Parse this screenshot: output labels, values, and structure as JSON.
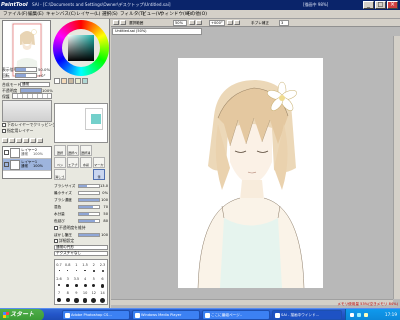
{
  "app": {
    "logo": "PaintTool SAI",
    "title": "SAI - [C:\\Documents and Settings\\Owner\\デスクトップ\\Untitled.sai]",
    "corner_status": "[描画中 98%]"
  },
  "window_buttons": [
    "_",
    "□",
    "×"
  ],
  "menu": [
    "ファイル(F)",
    "編集(E)",
    "キャンバス(C)",
    "レイヤー(L)",
    "選択(S)",
    "フィルタ(T)",
    "ビュー(V)",
    "ウィンドウ(W)",
    "その他(O)"
  ],
  "navigator": {
    "zoom_label": "表示倍率",
    "zoom_value": "50.0%",
    "angle_label": "回転",
    "angle_value": "+0°"
  },
  "layer_settings": {
    "mode_label": "合成モード",
    "mode_value": "通常",
    "opacity_label": "不透明度",
    "opacity_value": "100%",
    "protect_label": "保護",
    "clip_label": "下のレイヤーでクリッピング",
    "select_source_label": "指定用レイヤー"
  },
  "layers": [
    {
      "name": "レイヤー2",
      "mode": "通常",
      "opacity": "100%",
      "selected": false
    },
    {
      "name": "レイヤー1",
      "mode": "通常",
      "opacity": "100%",
      "selected": true
    }
  ],
  "tools": [
    "選択",
    "選択ペン",
    "選択消し",
    "ペン",
    "エアブラシ",
    "水彩",
    "マーカー",
    "消しゴム",
    "筆"
  ],
  "tool_props": {
    "size_label": "ブラシサイズ",
    "size_value": "13.0",
    "min_size_label": "最小サイズ",
    "min_size_value": "0%",
    "density_label": "ブラシ濃度",
    "density_value": "100",
    "blend_label": "混色",
    "blend_value": "70",
    "dilution_label": "水分量",
    "dilution_value": "50",
    "persist_label": "色延び",
    "persist_value": "80",
    "keep_opacity_label": "不透明度を維持",
    "blur_label": "ぼかし筆圧",
    "blur_value": "100",
    "detail_label": "詳細設定",
    "shape_label": "通常の円形",
    "texture_label": "テクスチャなし"
  },
  "size_presets": [
    "0.7",
    "0.8",
    "1",
    "1.5",
    "2",
    "2.3",
    "2.6",
    "3",
    "3.5",
    "4",
    "5",
    "6",
    "7",
    "8",
    "9",
    "10",
    "12",
    "14"
  ],
  "canvas_toolbar": {
    "select_label": "選択範囲",
    "zoom_value": "50%",
    "angle_value": "+000°",
    "stabilizer_label": "手ブレ補正",
    "stabilizer_value": "3"
  },
  "document_tab": "Untitled.sai (50%)",
  "status": {
    "memory": "メモリ使用量 53%(空きメモリ 84%)"
  },
  "taskbar": {
    "start": "スタート",
    "tasks": [
      "Adobe Photoshop CS...",
      "Windows Media Player",
      "ここに番組ページ..",
      "SAI - 描画中ウインド..."
    ],
    "clock": "17:19"
  },
  "colors": {
    "titlebar": "#0a246a",
    "taskbar": "#2355c8",
    "accent": "#16b0a8"
  }
}
